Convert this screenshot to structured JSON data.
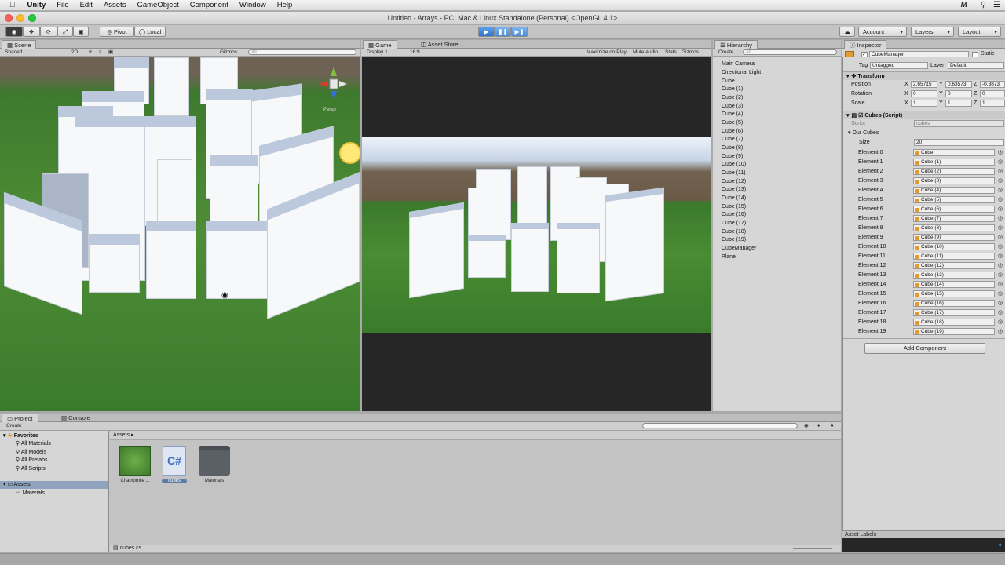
{
  "menubar": {
    "app": "Unity",
    "items": [
      "File",
      "Edit",
      "Assets",
      "GameObject",
      "Component",
      "Window",
      "Help"
    ],
    "right_icon": "M"
  },
  "window": {
    "title": "Untitled - Arrays - PC, Mac & Linux Standalone (Personal) <OpenGL 4.1>"
  },
  "toolbar": {
    "pivot": "Pivot",
    "local": "Local",
    "account": "Account",
    "layers": "Layers",
    "layout": "Layout"
  },
  "scene": {
    "tab": "Scene",
    "shading": "Shaded",
    "mode_2d": "2D",
    "gizmos": "Gizmos",
    "search": "All",
    "persp": "Persp"
  },
  "game": {
    "tab": "Game",
    "tab2": "Asset Store",
    "display": "Display 1",
    "aspect": "16:9",
    "maximize": "Maximize on Play",
    "mute": "Mute audio",
    "stats": "Stats",
    "gizmos": "Gizmos"
  },
  "hierarchy": {
    "tab": "Hierarchy",
    "create": "Create",
    "search": "All",
    "items": [
      "Main Camera",
      "Directional Light",
      "Cube",
      "Cube (1)",
      "Cube (2)",
      "Cube (3)",
      "Cube (4)",
      "Cube (5)",
      "Cube (6)",
      "Cube (7)",
      "Cube (8)",
      "Cube (9)",
      "Cube (10)",
      "Cube (11)",
      "Cube (12)",
      "Cube (13)",
      "Cube (14)",
      "Cube (15)",
      "Cube (16)",
      "Cube (17)",
      "Cube (18)",
      "Cube (19)",
      "CubeManager",
      "Plane"
    ]
  },
  "inspector": {
    "tab": "Inspector",
    "object_name": "CubeManager",
    "static": "Static",
    "tag_label": "Tag",
    "tag": "Untagged",
    "layer_label": "Layer",
    "layer": "Default",
    "transform": {
      "title": "Transform",
      "position_label": "Position",
      "rotation_label": "Rotation",
      "scale_label": "Scale",
      "position": [
        "2.65715",
        "0.63573",
        "-0.3873"
      ],
      "rotation": [
        "0",
        "0",
        "0"
      ],
      "scale": [
        "1",
        "1",
        "1"
      ],
      "axes": [
        "X",
        "Y",
        "Z"
      ]
    },
    "script": {
      "title": "Cubes (Script)",
      "script_label": "Script",
      "script_value": "cubes",
      "array_label": "Our Cubes",
      "size_label": "Size",
      "size": "20",
      "elements": [
        {
          "label": "Element 0",
          "value": "Cube"
        },
        {
          "label": "Element 1",
          "value": "Cube (1)"
        },
        {
          "label": "Element 2",
          "value": "Cube (2)"
        },
        {
          "label": "Element 3",
          "value": "Cube (3)"
        },
        {
          "label": "Element 4",
          "value": "Cube (4)"
        },
        {
          "label": "Element 5",
          "value": "Cube (5)"
        },
        {
          "label": "Element 6",
          "value": "Cube (6)"
        },
        {
          "label": "Element 7",
          "value": "Cube (7)"
        },
        {
          "label": "Element 8",
          "value": "Cube (8)"
        },
        {
          "label": "Element 9",
          "value": "Cube (9)"
        },
        {
          "label": "Element 10",
          "value": "Cube (10)"
        },
        {
          "label": "Element 11",
          "value": "Cube (11)"
        },
        {
          "label": "Element 12",
          "value": "Cube (12)"
        },
        {
          "label": "Element 13",
          "value": "Cube (13)"
        },
        {
          "label": "Element 14",
          "value": "Cube (14)"
        },
        {
          "label": "Element 15",
          "value": "Cube (15)"
        },
        {
          "label": "Element 16",
          "value": "Cube (16)"
        },
        {
          "label": "Element 17",
          "value": "Cube (17)"
        },
        {
          "label": "Element 18",
          "value": "Cube (18)"
        },
        {
          "label": "Element 19",
          "value": "Cube (19)"
        }
      ]
    },
    "add_component": "Add Component",
    "asset_labels": "Asset Labels"
  },
  "project": {
    "tab": "Project",
    "tab2": "Console",
    "create": "Create",
    "favorites_label": "Favorites",
    "favorites": [
      "All Materials",
      "All Models",
      "All Prefabs",
      "All Scripts"
    ],
    "assets_label": "Assets",
    "materials_folder": "Materials",
    "breadcrumb": "Assets",
    "assets": [
      "Chamomile ...",
      "cubes",
      "Materials"
    ],
    "selected_file": "cubes.cs"
  },
  "colors": {
    "accent": "#2f73c8",
    "panel": "#d6d6d6",
    "grass": "#4a8c33"
  }
}
